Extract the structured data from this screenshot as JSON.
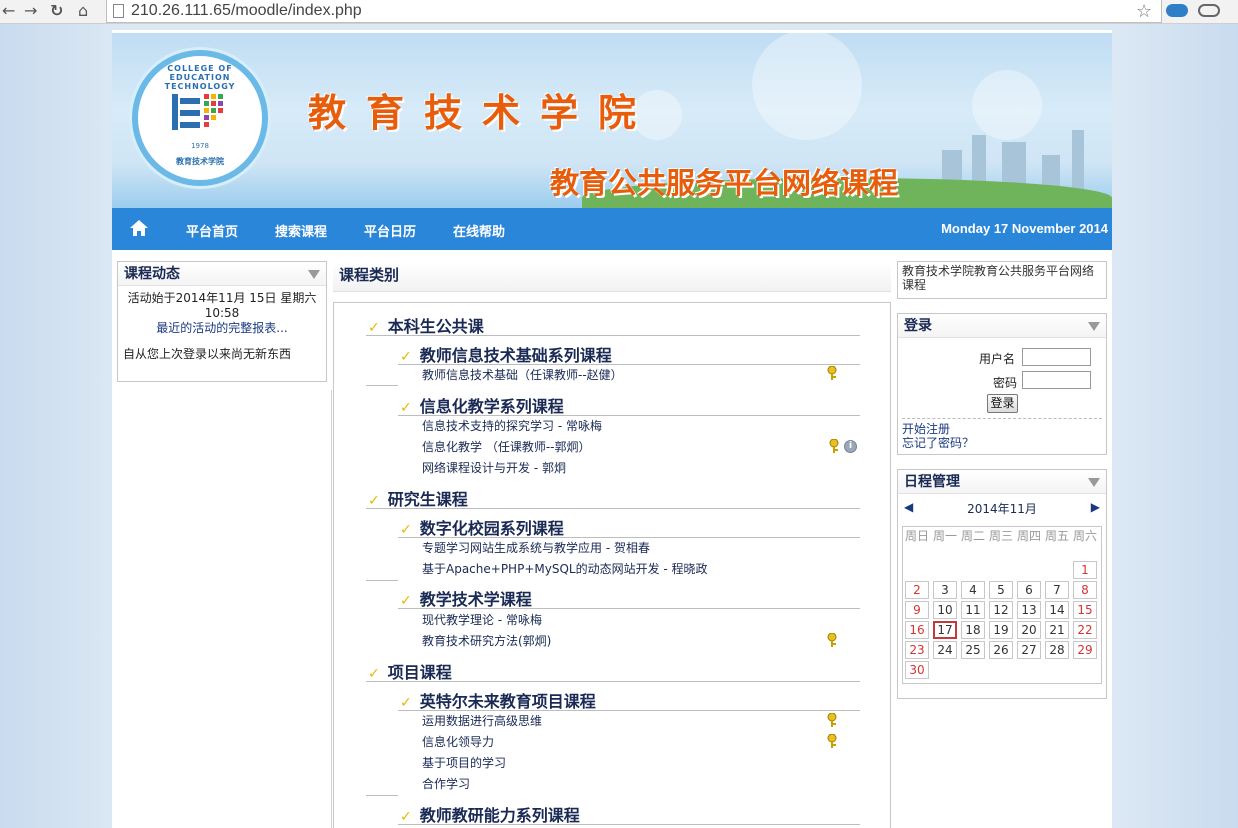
{
  "browser": {
    "url": "210.26.111.65/moodle/index.php"
  },
  "banner": {
    "title": "教育技术学院",
    "subtitle": "教育公共服务平台网络课程",
    "logo_text_top": "COLLEGE OF EDUCATION TECHNOLOGY",
    "logo_year": "1978",
    "logo_text_bottom": "教育技术学院"
  },
  "nav": {
    "items": [
      "平台首页",
      "搜索课程",
      "平台日历",
      "在线帮助"
    ],
    "date": "Monday 17 November 2014"
  },
  "activity_block": {
    "title": "课程动态",
    "since": "活动始于2014年11月 15日 星期六 10:58",
    "report_link": "最近的活动的完整报表...",
    "none": "自从您上次登录以来尚无新东西"
  },
  "categories": {
    "title": "课程类别",
    "top1": "本科生公共课",
    "sub1": "教师信息技术基础系列课程",
    "c1": "教师信息技术基础（任课教师--赵健）",
    "sub2": "信息化教学系列课程",
    "c2": "信息技术支持的探究学习 - 常咏梅",
    "c3": "信息化教学 （任课教师--郭炯）",
    "c4": "网络课程设计与开发 - 郭炯",
    "top2": "研究生课程",
    "sub3": "数字化校园系列课程",
    "c5": "专题学习网站生成系统与教学应用 - 贺相春",
    "c6": "基于Apache+PHP+MySQL的动态网站开发 - 程晓政",
    "sub4": "教学技术学课程",
    "c7": "现代教学理论 - 常咏梅",
    "c8": "教育技术研究方法(郭炯)",
    "top3": "项目课程",
    "sub5": "英特尔未来教育项目课程",
    "c9": "运用数据进行高级思维",
    "c10": "信息化领导力",
    "c11": "基于项目的学习",
    "c12": "合作学习",
    "sub6": "教师教研能力系列课程"
  },
  "site_desc": "教育技术学院教育公共服务平台网络课程",
  "login": {
    "title": "登录",
    "username_label": "用户名",
    "password_label": "密码",
    "button": "登录",
    "signup": "开始注册",
    "forgot": "忘记了密码？"
  },
  "calendar": {
    "title": "日程管理",
    "month": "2014年11月",
    "weekdays": [
      "周日",
      "周一",
      "周二",
      "周三",
      "周四",
      "周五",
      "周六"
    ],
    "weeks": [
      [
        "",
        "",
        "",
        "",
        "",
        "",
        "1"
      ],
      [
        "2",
        "3",
        "4",
        "5",
        "6",
        "7",
        "8"
      ],
      [
        "9",
        "10",
        "11",
        "12",
        "13",
        "14",
        "15"
      ],
      [
        "16",
        "17",
        "18",
        "19",
        "20",
        "21",
        "22"
      ],
      [
        "23",
        "24",
        "25",
        "26",
        "27",
        "28",
        "29"
      ],
      [
        "30",
        "",
        "",
        "",
        "",
        "",
        ""
      ]
    ],
    "today": "17"
  },
  "colors": {
    "accent": "#2a86d8",
    "title_orange": "#e85d0c",
    "link": "#1a3a80",
    "weekend": "#d63333"
  }
}
